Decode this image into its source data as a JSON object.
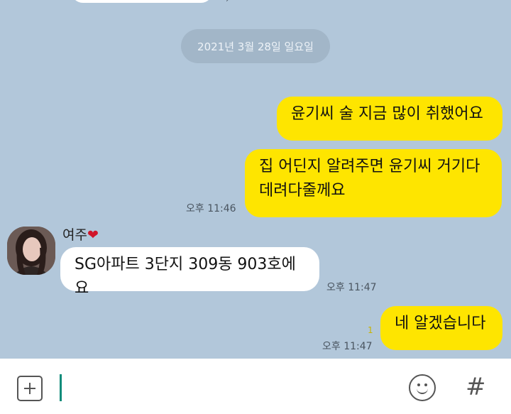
{
  "date_divider": "2021년 3월 28일 일요일",
  "messages": [
    {
      "text": "윤기씨 술 지금 많이 취했어요"
    },
    {
      "lines": [
        "집 어딘지 알려주면 윤기씨 거기다",
        "데려다줄께요"
      ],
      "time": "오후 11:46"
    },
    {
      "sender": "여주",
      "sender_heart": "❤",
      "text": "SG아파트 3단지 309동 903호에요",
      "time": "오후 11:47"
    },
    {
      "text": "네 알겠습니다",
      "unread": "1",
      "time": "오후 11:47"
    }
  ],
  "input": {
    "value": "",
    "placeholder": ""
  },
  "icons": {
    "attach": "plus-square-icon",
    "emoji": "smiley-icon",
    "hashtag": "#"
  },
  "colors": {
    "background": "#b2c7da",
    "my_bubble": "#fee500",
    "their_bubble": "#ffffff"
  }
}
